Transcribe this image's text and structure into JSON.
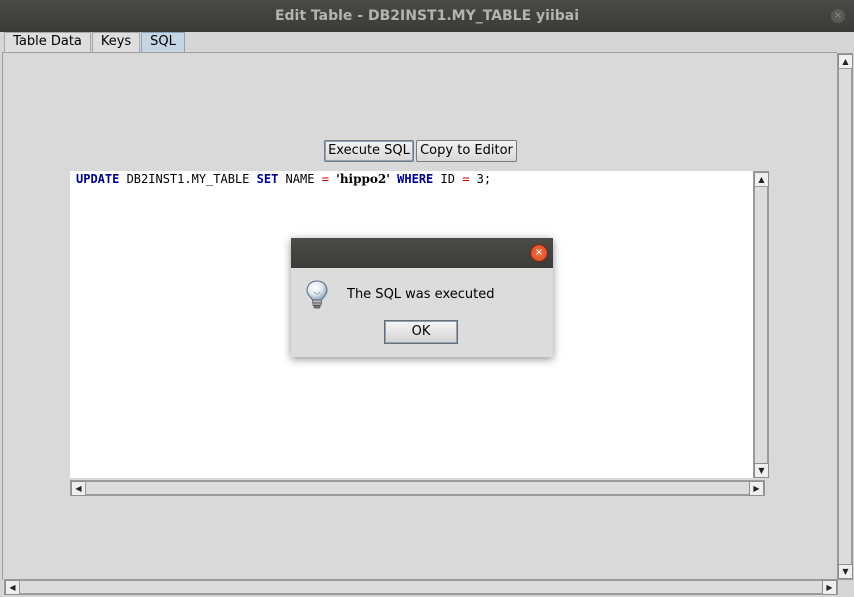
{
  "window": {
    "title": "Edit Table - DB2INST1.MY_TABLE yiibai",
    "close_glyph": "×"
  },
  "tabs": [
    {
      "label": "Table Data"
    },
    {
      "label": "Keys"
    },
    {
      "label": "SQL",
      "active": true
    }
  ],
  "toolbar": {
    "execute_label": "Execute SQL",
    "copy_label": "Copy to Editor"
  },
  "sql": {
    "kw_update": "UPDATE",
    "table": " DB2INST1.MY_TABLE ",
    "kw_set": "SET",
    "col_part": " NAME ",
    "eq1": "=",
    "space1": " ",
    "value": "'hippo2'",
    "space2": " ",
    "kw_where": "WHERE",
    "where_col": " ID ",
    "eq2": "=",
    "id_value": " 3;"
  },
  "dialog": {
    "message": "The SQL was executed",
    "ok_label": "OK",
    "close_glyph": "×",
    "icon": "info-lightbulb-icon"
  },
  "scroll": {
    "up": "▲",
    "down": "▼",
    "left": "◀",
    "right": "▶"
  }
}
